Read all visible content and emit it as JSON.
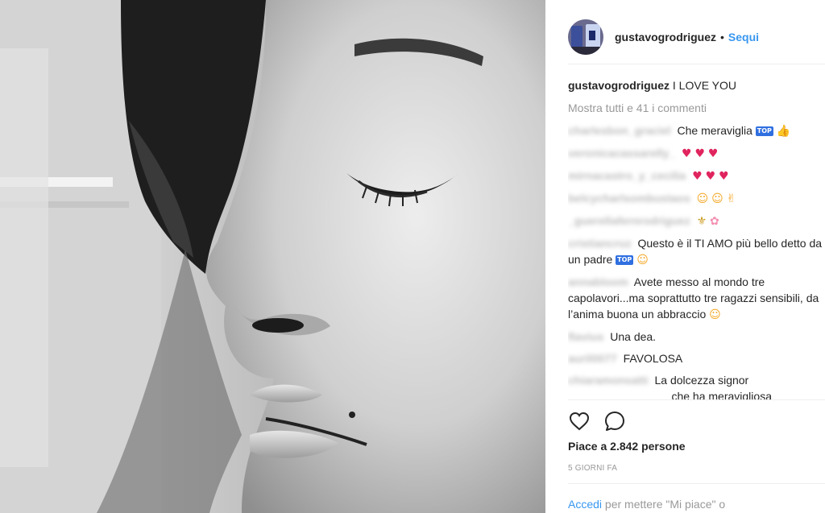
{
  "post": {
    "username": "gustavogrodriguez",
    "separator": "•",
    "follow_label": "Sequi",
    "caption_user": "gustavogrodriguez",
    "caption_text": "I LOVE YOU",
    "view_all": "Mostra tutti e 41 i commenti"
  },
  "comments": [
    {
      "user": "charlesbon_graciel",
      "text": "Che meraviglia",
      "emojis": [
        "top-icon",
        "thumbs-up-icon"
      ]
    },
    {
      "user": "veronicacassarelly_",
      "text": "",
      "emojis": [
        "heart-icon",
        "heart-icon",
        "heart-icon"
      ]
    },
    {
      "user": "mirnacastro_y_cecilia",
      "text": "",
      "emojis": [
        "sparkling-heart-icon",
        "sparkling-heart-icon",
        "sparkling-heart-icon"
      ]
    },
    {
      "user": "belcycharlsombustaos",
      "text": "",
      "emojis": [
        "heart-eyes-icon",
        "heart-eyes-icon",
        "fingers-crossed-icon"
      ]
    },
    {
      "user": "_guerellafernrodriguez",
      "text": "",
      "emojis": [
        "fleur-de-lis-icon",
        "blossom-icon"
      ]
    },
    {
      "user": "cristiancruz",
      "text": "Questo è il TI AMO più bello detto da un padre",
      "emojis": [
        "top-icon",
        "heart-eyes-icon"
      ]
    },
    {
      "user": "annabloom",
      "text": "Avete messo al mondo tre capolavori...ma soprattutto tre ragazzi sensibili, da l’anima buona un abbraccio",
      "emojis": [
        "kiss-icon"
      ]
    },
    {
      "user": "flavius",
      "text": "Una dea.",
      "emojis": []
    },
    {
      "user": "auril0077",
      "text": "FAVOLOSA",
      "emojis": []
    },
    {
      "user": "chiaramonsatti",
      "text": "La dolcezza signor ________________ che ha meravigliosa",
      "emojis": []
    }
  ],
  "stats": {
    "likes": "Piace a 2.842 persone",
    "time": "5 GIORNI FA"
  },
  "login": {
    "link": "Accedi",
    "text": " per mettere \"Mi piace\" o"
  },
  "icons": {
    "like": "heart-outline-icon",
    "comment": "comment-bubble-icon"
  },
  "colors": {
    "link_blue": "#3897f0",
    "text": "#262626",
    "muted": "#999999"
  }
}
